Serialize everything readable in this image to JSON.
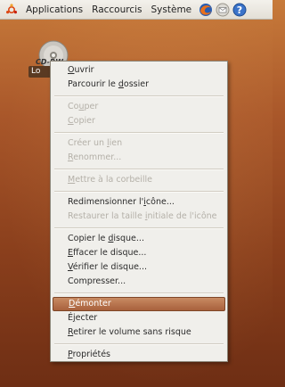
{
  "panel": {
    "menus": [
      "Applications",
      "Raccourcis",
      "Système"
    ]
  },
  "desktop": {
    "icon_disc_text": "CD-RW",
    "icon_label": "Lo"
  },
  "context_menu": {
    "groups": [
      [
        {
          "pre": "",
          "acc": "O",
          "post": "uvrir",
          "enabled": true
        },
        {
          "pre": "Parcourir le ",
          "acc": "d",
          "post": "ossier",
          "enabled": true
        }
      ],
      [
        {
          "pre": "Co",
          "acc": "u",
          "post": "per",
          "enabled": false
        },
        {
          "pre": "",
          "acc": "C",
          "post": "opier",
          "enabled": false
        }
      ],
      [
        {
          "pre": "Créer un ",
          "acc": "l",
          "post": "ien",
          "enabled": false
        },
        {
          "pre": "",
          "acc": "R",
          "post": "enommer...",
          "enabled": false
        }
      ],
      [
        {
          "pre": "",
          "acc": "M",
          "post": "ettre à la corbeille",
          "enabled": false
        }
      ],
      [
        {
          "pre": "Redimensionner l'",
          "acc": "i",
          "post": "cône...",
          "enabled": true
        },
        {
          "pre": "Restaurer la taille ",
          "acc": "i",
          "post": "nitiale de l'icône",
          "enabled": false
        }
      ],
      [
        {
          "pre": "Copier le ",
          "acc": "d",
          "post": "isque...",
          "enabled": true
        },
        {
          "pre": "",
          "acc": "E",
          "post": "ffacer le disque...",
          "enabled": true
        },
        {
          "pre": "",
          "acc": "V",
          "post": "érifier le disque...",
          "enabled": true
        },
        {
          "pre": "Compresser...",
          "acc": "",
          "post": "",
          "enabled": true
        }
      ],
      [
        {
          "pre": "",
          "acc": "D",
          "post": "émonter",
          "enabled": true,
          "highlighted": true
        },
        {
          "pre": "É",
          "acc": "j",
          "post": "ecter",
          "enabled": true
        },
        {
          "pre": "",
          "acc": "R",
          "post": "etirer le volume sans risque",
          "enabled": true
        }
      ],
      [
        {
          "pre": "",
          "acc": "P",
          "post": "ropriétés",
          "enabled": true
        }
      ]
    ]
  }
}
